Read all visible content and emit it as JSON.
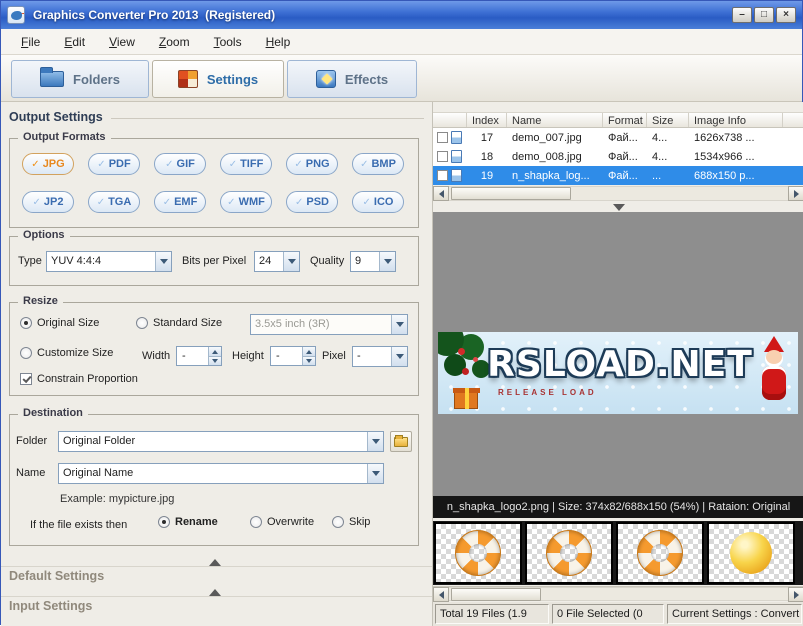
{
  "window": {
    "title": "Graphics Converter Pro 2013  (Registered)",
    "controls": {
      "minimize": "–",
      "maximize": "□",
      "close": "×"
    }
  },
  "icons": {
    "check": "✓"
  },
  "menu": {
    "items": [
      "File",
      "Edit",
      "View",
      "Zoom",
      "Tools",
      "Help"
    ]
  },
  "tabs": [
    {
      "label": "Folders",
      "active": false
    },
    {
      "label": "Settings",
      "active": true
    },
    {
      "label": "Effects",
      "active": false
    }
  ],
  "left_panel": {
    "title": "Output Settings",
    "formats": {
      "title": "Output Formats",
      "buttons": [
        "JPG",
        "PDF",
        "GIF",
        "TIFF",
        "PNG",
        "BMP",
        "JP2",
        "TGA",
        "EMF",
        "WMF",
        "PSD",
        "ICO"
      ],
      "selected": "JPG"
    },
    "options": {
      "title": "Options",
      "type_label": "Type",
      "type_value": "YUV 4:4:4",
      "bits_label": "Bits per Pixel",
      "bits_value": "24",
      "quality_label": "Quality",
      "quality_value": "9"
    },
    "resize": {
      "title": "Resize",
      "original": "Original Size",
      "standard": "Standard Size",
      "standard_value": "3.5x5 inch (3R)",
      "customize": "Customize Size",
      "width_label": "Width",
      "width_value": "-",
      "height_label": "Height",
      "height_value": "-",
      "pixel_label": "Pixel",
      "pixel_value": "-",
      "constrain": "Constrain Proportion",
      "selected_mode": "Original Size",
      "constrain_checked": true
    },
    "destination": {
      "title": "Destination",
      "folder_label": "Folder",
      "folder_value": "Original Folder",
      "name_label": "Name",
      "name_value": "Original Name",
      "example": "Example: mypicture.jpg",
      "exists_label": "If the file exists then",
      "rename": "Rename",
      "overwrite": "Overwrite",
      "skip": "Skip",
      "exists_selected": "Rename"
    },
    "default_settings_title": "Default Settings",
    "input_settings_title": "Input Settings"
  },
  "file_table": {
    "columns": [
      "Index",
      "Name",
      "Format",
      "Size",
      "Image Info"
    ],
    "rows": [
      {
        "index": "17",
        "name": "demo_007.jpg",
        "format": "Фай...",
        "size": "4...",
        "info": "1626x738 ..."
      },
      {
        "index": "18",
        "name": "demo_008.jpg",
        "format": "Фай...",
        "size": "4...",
        "info": "1534x966 ..."
      },
      {
        "index": "19",
        "name": "n_shapka_log...",
        "format": "Фай...",
        "size": "...",
        "info": "688x150 p..."
      }
    ],
    "selected_index": "19"
  },
  "preview": {
    "status": "n_shapka_logo2.png  |  Size: 374x82/688x150 (54%)  |  Rataion: Original",
    "banner_text": "RSLOAD.NET",
    "banner_subtext": "RELEASE LOAD"
  },
  "status_bar": {
    "total": "Total 19 Files (1.9",
    "selected": "0 File Selected (0",
    "settings": "Current Settings : Convert Current Fil"
  },
  "colors": {
    "titlebar": "#3d6fd4",
    "selection": "#2f8ce8",
    "format_selected": "#e8881f"
  }
}
